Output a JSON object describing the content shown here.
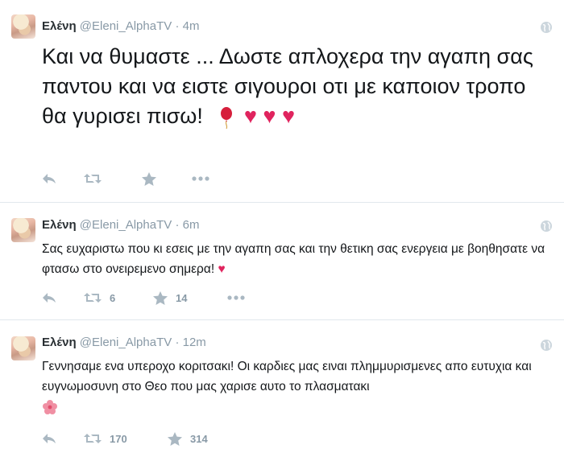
{
  "tweets": [
    {
      "fullname": "Ελένη",
      "handle": "@Eleni_AlphaTV",
      "separator": "·",
      "time": "4m",
      "text": "Και να θυμαστε ... Δωστε απλοχερα την αγαπη σας παντου και να ειστε σιγουροι οτι με καποιον τροπο θα γυρισει πισω!",
      "emoji_after_text": [
        "balloon",
        "heart",
        "heart",
        "heart"
      ],
      "retweets": "",
      "favorites": ""
    },
    {
      "fullname": "Ελένη",
      "handle": "@Eleni_AlphaTV",
      "separator": "·",
      "time": "6m",
      "text": "Σας ευχαριστω που κι εσεις με την αγαπη σας και την θετικη σας ενεργεια με βοηθησατε να φτασω στο ονειρεμενο σημερα!",
      "emoji_after_text": [
        "heart"
      ],
      "retweets": "6",
      "favorites": "14"
    },
    {
      "fullname": "Ελένη",
      "handle": "@Eleni_AlphaTV",
      "separator": "·",
      "time": "12m",
      "text": "Γεννησαμε ενα υπεροχο κοριτσακι! Οι καρδιες μας ειναι πλημμυρισμενες απο ευτυχια και ευγνωμοσυνη στο Θεο που μας χαρισε αυτο το πλασματακι",
      "emoji_after_text": [
        "hibiscus"
      ],
      "retweets": "170",
      "favorites": "314"
    }
  ],
  "icons": {
    "reply": "reply-icon",
    "retweet": "retweet-icon",
    "favorite": "star-icon",
    "more": "more-icon",
    "globe": "globe-icon"
  },
  "colors": {
    "name": "#292f33",
    "muted": "#8899a6",
    "icon": "#aab8c2",
    "heart": "#e0245e",
    "divider": "#e1e8ed"
  }
}
